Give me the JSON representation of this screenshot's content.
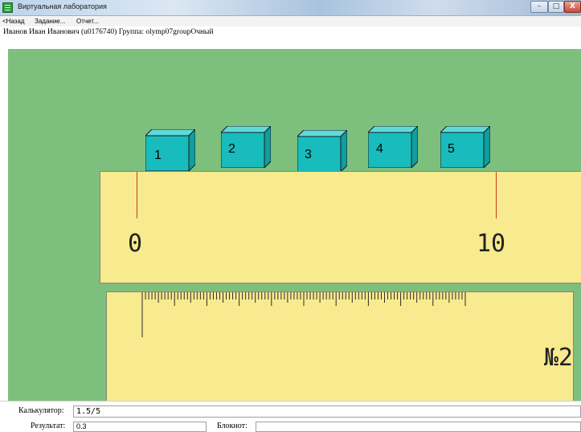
{
  "window": {
    "title": "Виртуальная лаборатория",
    "buttons": {
      "minimize": "–",
      "maximize": "□",
      "close": "X"
    }
  },
  "menu": {
    "items": [
      {
        "label": "<Назад"
      },
      {
        "label": "Задание..."
      },
      {
        "label": "Отчет..."
      }
    ]
  },
  "user": {
    "info": "Иванов Иван Иванович (u0176740)  Группа: olymp07groupОчный"
  },
  "cubes": [
    {
      "number": "1"
    },
    {
      "number": "2"
    },
    {
      "number": "3"
    },
    {
      "number": "4"
    },
    {
      "number": "5"
    }
  ],
  "colors": {
    "background": "#7dbf7d",
    "cube_face": "#19bcbc",
    "ruler": "#f8ea8f",
    "marker": "#cc3b1e"
  },
  "ruler1": {
    "start_label": "0",
    "end_label": "10"
  },
  "ruler2": {
    "label": "№2"
  },
  "bottom": {
    "calculator_label": "Калькулятор:",
    "calculator_value": "1.5/5",
    "result_label": "Результат:",
    "result_value": "0.3",
    "notepad_label": "Блокнот:"
  }
}
